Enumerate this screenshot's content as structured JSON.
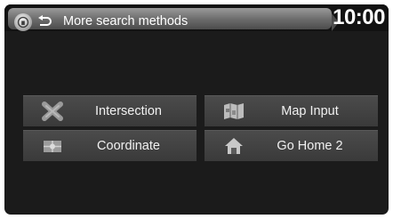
{
  "header": {
    "title": "More search methods",
    "clock": "10:00",
    "home_icon": "home-circle-icon",
    "back_icon": "back-arrow-icon"
  },
  "menu": {
    "items": [
      {
        "label": "Intersection",
        "icon": "intersection-icon"
      },
      {
        "label": "Map Input",
        "icon": "map-input-icon"
      },
      {
        "label": "Coordinate",
        "icon": "coordinate-icon"
      },
      {
        "label": "Go Home 2",
        "icon": "home-icon"
      }
    ]
  }
}
